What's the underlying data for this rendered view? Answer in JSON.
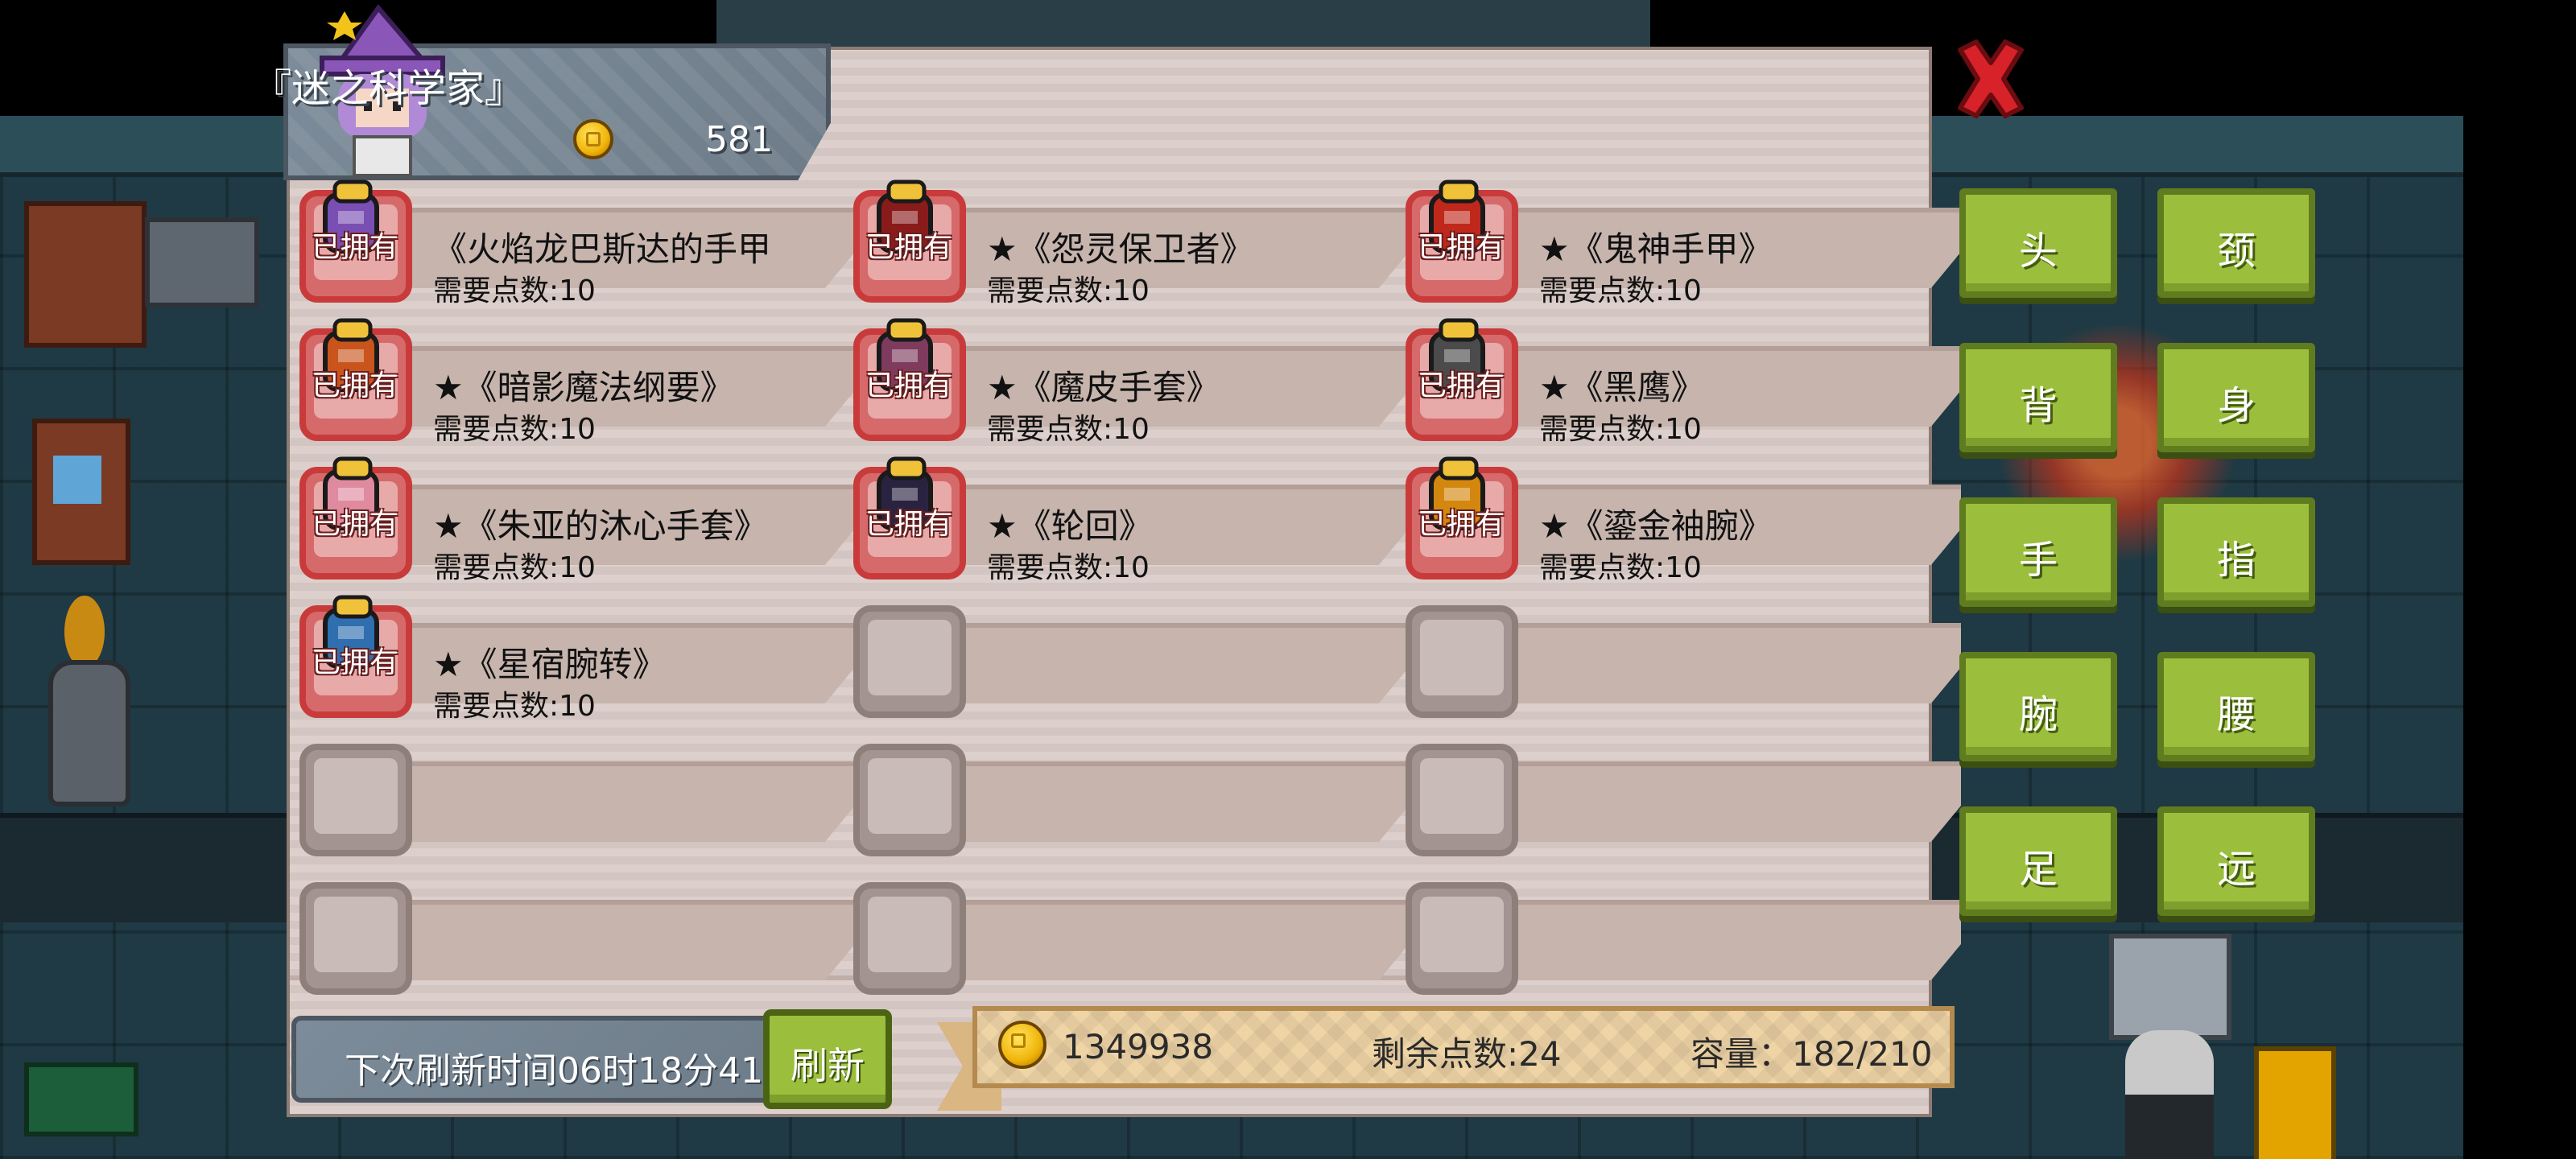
{
  "header": {
    "title": "『迷之科学家』",
    "gold": "581"
  },
  "items": [
    {
      "name": "《火焰龙巴斯达的手甲",
      "cost": "需要点数:10",
      "owned": true,
      "owned_label": "已拥有",
      "icon": "purple-gauntlet-icon",
      "color": "#7a4fb3"
    },
    {
      "name": "★《怨灵保卫者》",
      "cost": "需要点数:10",
      "owned": true,
      "owned_label": "已拥有",
      "icon": "crimson-claw-icon",
      "color": "#8a1b1b"
    },
    {
      "name": "★《鬼神手甲》",
      "cost": "需要点数:10",
      "owned": true,
      "owned_label": "已拥有",
      "icon": "demon-gauntlet-icon",
      "color": "#c0281c"
    },
    {
      "name": "★《暗影魔法纲要》",
      "cost": "需要点数:10",
      "owned": true,
      "owned_label": "已拥有",
      "icon": "spellbook-icon",
      "color": "#c9551d"
    },
    {
      "name": "★《魔皮手套》",
      "cost": "需要点数:10",
      "owned": true,
      "owned_label": "已拥有",
      "icon": "leather-glove-icon",
      "color": "#7e3b5e"
    },
    {
      "name": "★《黑鹰》",
      "cost": "需要点数:10",
      "owned": true,
      "owned_label": "已拥有",
      "icon": "black-eagle-icon",
      "color": "#4b4b4b"
    },
    {
      "name": "★《朱亚的沐心手套》",
      "cost": "需要点数:10",
      "owned": true,
      "owned_label": "已拥有",
      "icon": "pink-glove-icon",
      "color": "#e08aa0"
    },
    {
      "name": "★《轮回》",
      "cost": "需要点数:10",
      "owned": true,
      "owned_label": "已拥有",
      "icon": "cycle-gauntlet-icon",
      "color": "#2a2340"
    },
    {
      "name": "★《鎏金袖腕》",
      "cost": "需要点数:10",
      "owned": true,
      "owned_label": "已拥有",
      "icon": "gold-bracer-icon",
      "color": "#d4870f"
    },
    {
      "name": "★《星宿腕转》",
      "cost": "需要点数:10",
      "owned": true,
      "owned_label": "已拥有",
      "icon": "star-bracer-icon",
      "color": "#2f6fb0"
    },
    {
      "name": "",
      "cost": "",
      "owned": false
    },
    {
      "name": "",
      "cost": "",
      "owned": false
    },
    {
      "name": "",
      "cost": "",
      "owned": false
    },
    {
      "name": "",
      "cost": "",
      "owned": false
    },
    {
      "name": "",
      "cost": "",
      "owned": false
    },
    {
      "name": "",
      "cost": "",
      "owned": false
    },
    {
      "name": "",
      "cost": "",
      "owned": false
    },
    {
      "name": "",
      "cost": "",
      "owned": false
    }
  ],
  "categories": [
    "头",
    "颈",
    "背",
    "身",
    "手",
    "指",
    "腕",
    "腰",
    "足",
    "远"
  ],
  "bottom": {
    "refresh_time": "下次刷新时间06时18分41",
    "refresh_button": "刷新",
    "gold_total": "1349938",
    "points_left": "剩余点数:24",
    "capacity": "容量：182/210"
  },
  "colors": {
    "accent_green": "#9bbf3d",
    "close_red": "#d8222a",
    "panel_bg": "#d7cac6"
  }
}
